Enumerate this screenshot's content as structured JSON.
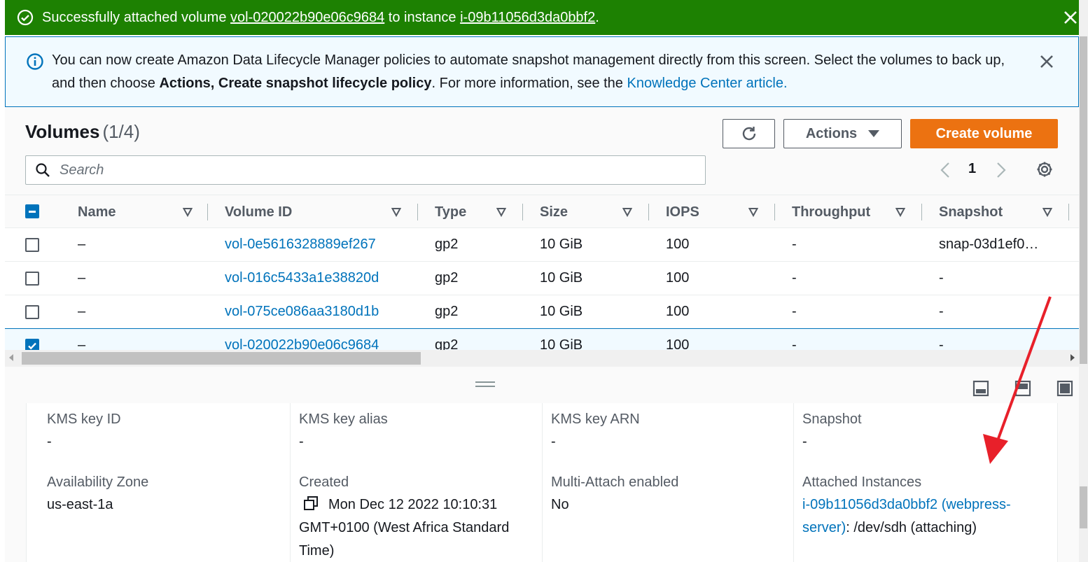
{
  "flash": {
    "prefix": "Successfully attached volume ",
    "volume_link": "vol-020022b90e06c9684",
    "middle": " to instance ",
    "instance_link": "i-09b11056d3da0bbf2",
    "suffix": "."
  },
  "info": {
    "part1": "You can now create Amazon Data Lifecycle Manager policies to automate snapshot management directly from this screen. Select the volumes to back up, and then choose ",
    "bold": "Actions, Create snapshot lifecycle policy",
    "part2": ". For more information, see the ",
    "link": "Knowledge Center article."
  },
  "header": {
    "title": "Volumes",
    "count": "(1/4)",
    "actions_label": "Actions",
    "create_label": "Create volume",
    "search_placeholder": "Search",
    "page": "1"
  },
  "columns": [
    "Name",
    "Volume ID",
    "Type",
    "Size",
    "IOPS",
    "Throughput",
    "Snapshot"
  ],
  "rows": [
    {
      "name": "–",
      "volume_id": "vol-0e5616328889ef267",
      "type": "gp2",
      "size": "10 GiB",
      "iops": "100",
      "throughput": "-",
      "snapshot": "snap-03d1ef0…",
      "selected": false
    },
    {
      "name": "–",
      "volume_id": "vol-016c5433a1e38820d",
      "type": "gp2",
      "size": "10 GiB",
      "iops": "100",
      "throughput": "-",
      "snapshot": "-",
      "selected": false
    },
    {
      "name": "–",
      "volume_id": "vol-075ce086aa3180d1b",
      "type": "gp2",
      "size": "10 GiB",
      "iops": "100",
      "throughput": "-",
      "snapshot": "-",
      "selected": false
    },
    {
      "name": "–",
      "volume_id": "vol-020022b90e06c9684",
      "type": "gp2",
      "size": "10 GiB",
      "iops": "100",
      "throughput": "-",
      "snapshot": "-",
      "selected": true
    }
  ],
  "details": {
    "kms_key_id_label": "KMS key ID",
    "kms_key_id": "-",
    "kms_key_alias_label": "KMS key alias",
    "kms_key_alias": "-",
    "kms_key_arn_label": "KMS key ARN",
    "kms_key_arn": "-",
    "snapshot_label": "Snapshot",
    "snapshot": "-",
    "az_label": "Availability Zone",
    "az": "us-east-1a",
    "created_label": "Created",
    "created_line1": "Mon Dec 12 2022 10:10:31",
    "created_line2": "GMT+0100 (West Africa Standard",
    "created_line3": "Time)",
    "multi_attach_label": "Multi-Attach enabled",
    "multi_attach": "No",
    "attached_label": "Attached Instances",
    "attached_link1": "i-09b11056d3da0bbf2 (webpress-",
    "attached_link2": "server)",
    "attached_suffix": ": /dev/sdh (attaching)"
  },
  "colors": {
    "success": "#1d8102",
    "info_bg": "#f1faff",
    "link": "#0073bb",
    "primary": "#ec7211",
    "annotation_arrow": "#e8202a"
  }
}
